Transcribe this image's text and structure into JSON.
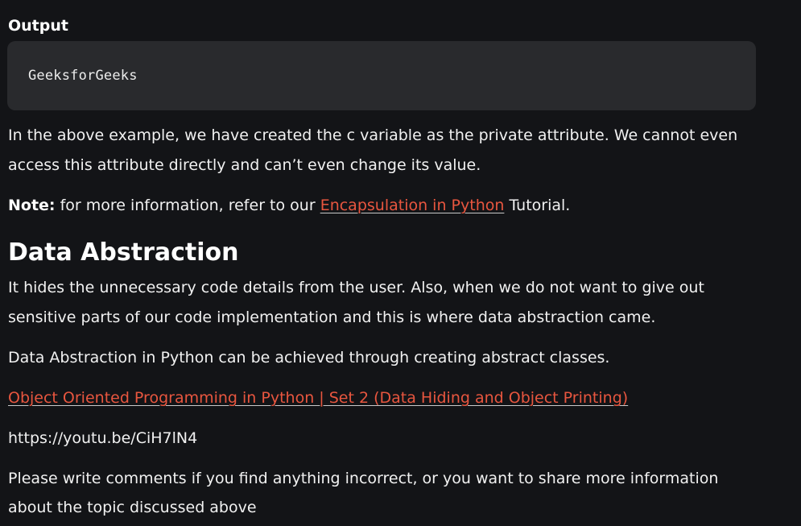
{
  "output_section": {
    "heading": "Output",
    "code": "GeeksforGeeks"
  },
  "paragraphs": {
    "p1": "In the above example, we have created the c variable as the private attribute. We cannot even access this attribute directly and can’t even change its value.",
    "note_label": "Note:",
    "note_text_before": " for more information, refer to our ",
    "note_link": "Encapsulation in Python",
    "note_text_after": " Tutorial."
  },
  "data_abstraction": {
    "heading": "Data Abstraction",
    "p1": "It hides the unnecessary code details from the user. Also,  when we do not want to give out sensitive parts of our code implementation and this is where data abstraction came.",
    "p2": "Data Abstraction in Python can be achieved through creating abstract classes.",
    "video_link": "Object Oriented Programming in Python | Set 2 (Data Hiding and Object Printing)",
    "url": "https://youtu.be/CiH7lN4",
    "comments": "Please write comments if you find anything incorrect, or you want to share more information about the topic discussed above"
  },
  "colors": {
    "background": "#131417",
    "code_background": "#292a2d",
    "link": "#e8563f",
    "text": "#f1f1f1"
  }
}
